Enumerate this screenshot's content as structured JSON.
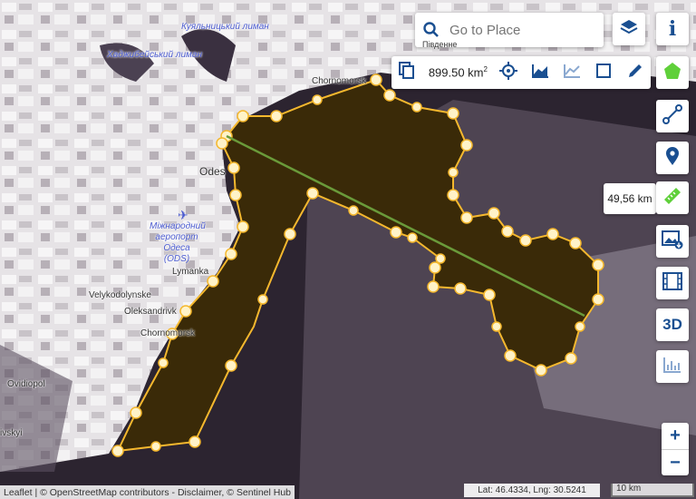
{
  "search": {
    "placeholder": "Go to Place",
    "partial_label": "Південне"
  },
  "toolbar": {
    "area_value": "899.50 km",
    "area_unit_sup": "2"
  },
  "measure": {
    "distance": "49,56 km"
  },
  "buttons": {
    "three_d": "3D",
    "zoom_in": "+",
    "zoom_out": "−"
  },
  "map_labels": {
    "odesa": "Odes",
    "chornomorsk_top": "Chornomorsk",
    "airport": "Міжнародний аеропорт Одеса (ODS)",
    "lymanka": "Lymanka",
    "velykodolynske": "Velykodolynske",
    "oleksandrivka": "Oleksandrivk",
    "chornomorsk": "Chornomorsk",
    "ovidiopol": "Ovidiopol",
    "bilgorod": "ivskyi",
    "lake_top": "Куяльницький лиман",
    "lake_left": "Хаджибейський лиман"
  },
  "attribution": "Leaflet | © OpenStreetMap contributors - Disclaimer, © Sentinel Hub",
  "coordinates": "Lat: 46.4334, Lng: 30.5241",
  "scale": "10 km",
  "colors": {
    "accent": "#1a4f91",
    "polygon_stroke": "#f5b82e",
    "polygon_fill": "#3a2a08",
    "measure_line": "#6a9a3a",
    "green_icon": "#5fd03a"
  }
}
